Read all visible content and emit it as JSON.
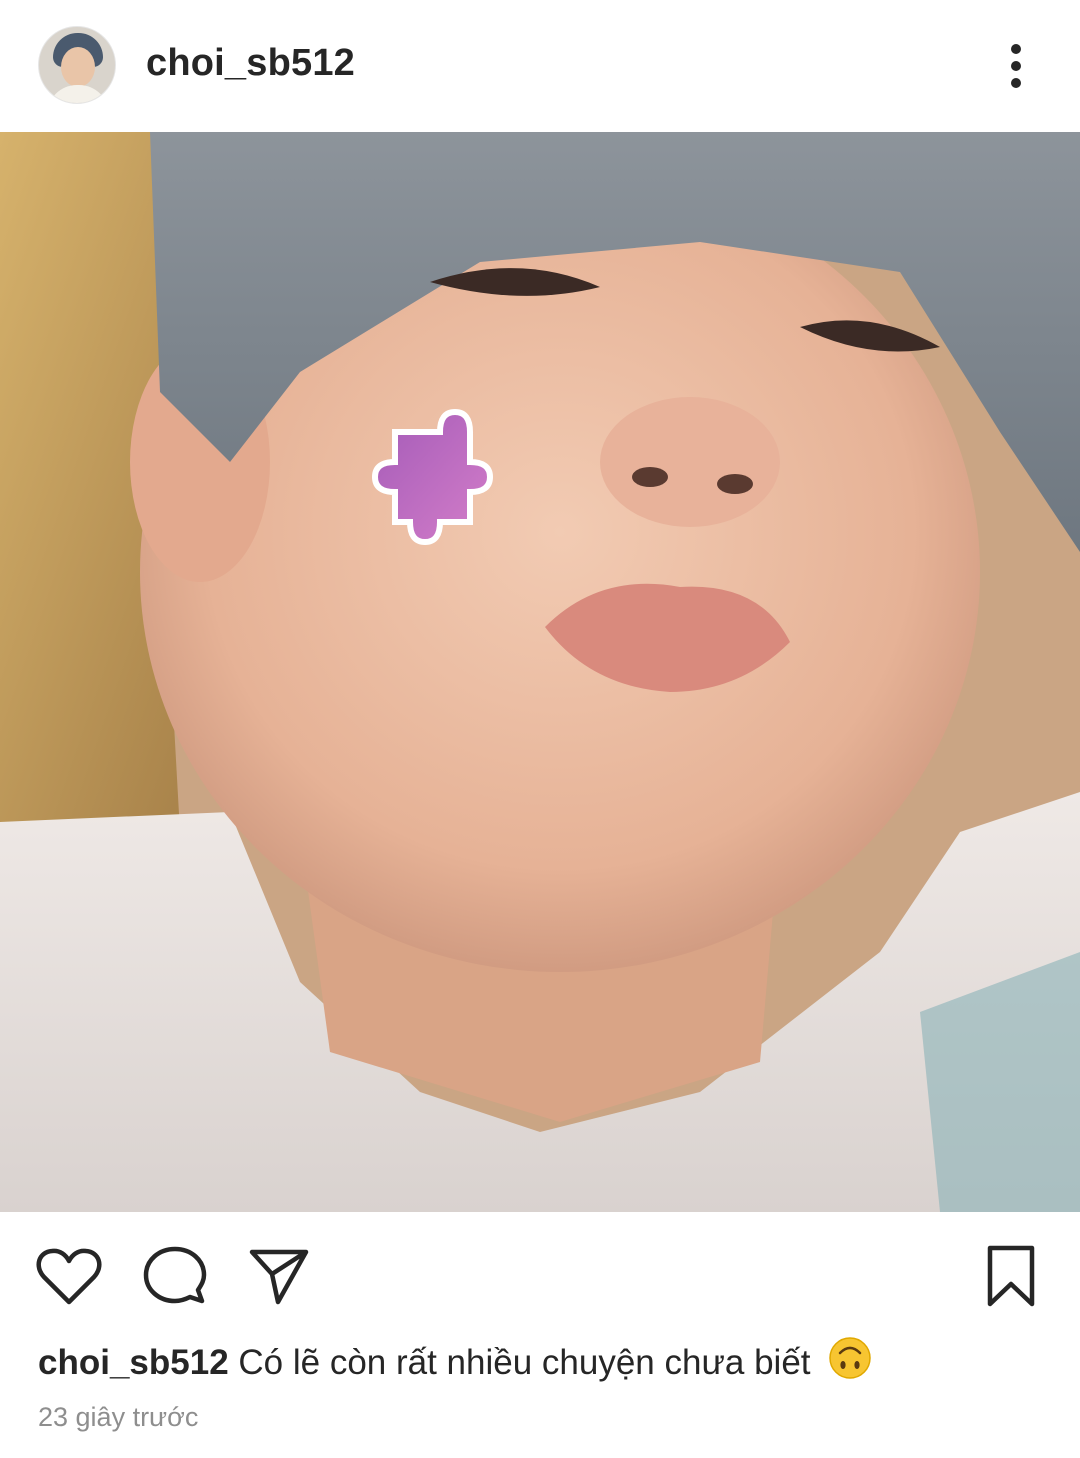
{
  "post": {
    "username": "choi_sb512",
    "caption_user": "choi_sb512",
    "caption_text": "Có lẽ còn rất nhiều chuyện chưa biết",
    "caption_emoji_icon": "upside-down-face-emoji-icon",
    "timestamp": "23 giây trước"
  },
  "icons": {
    "header": [
      "avatar",
      "more-options-icon"
    ],
    "actions": [
      "heart-icon",
      "comment-icon",
      "share-send-icon",
      "bookmark-icon"
    ]
  },
  "colors": {
    "text": "#262626",
    "secondary_text": "#8e8e8e",
    "background": "#ffffff",
    "emoji": "#f7c531"
  }
}
